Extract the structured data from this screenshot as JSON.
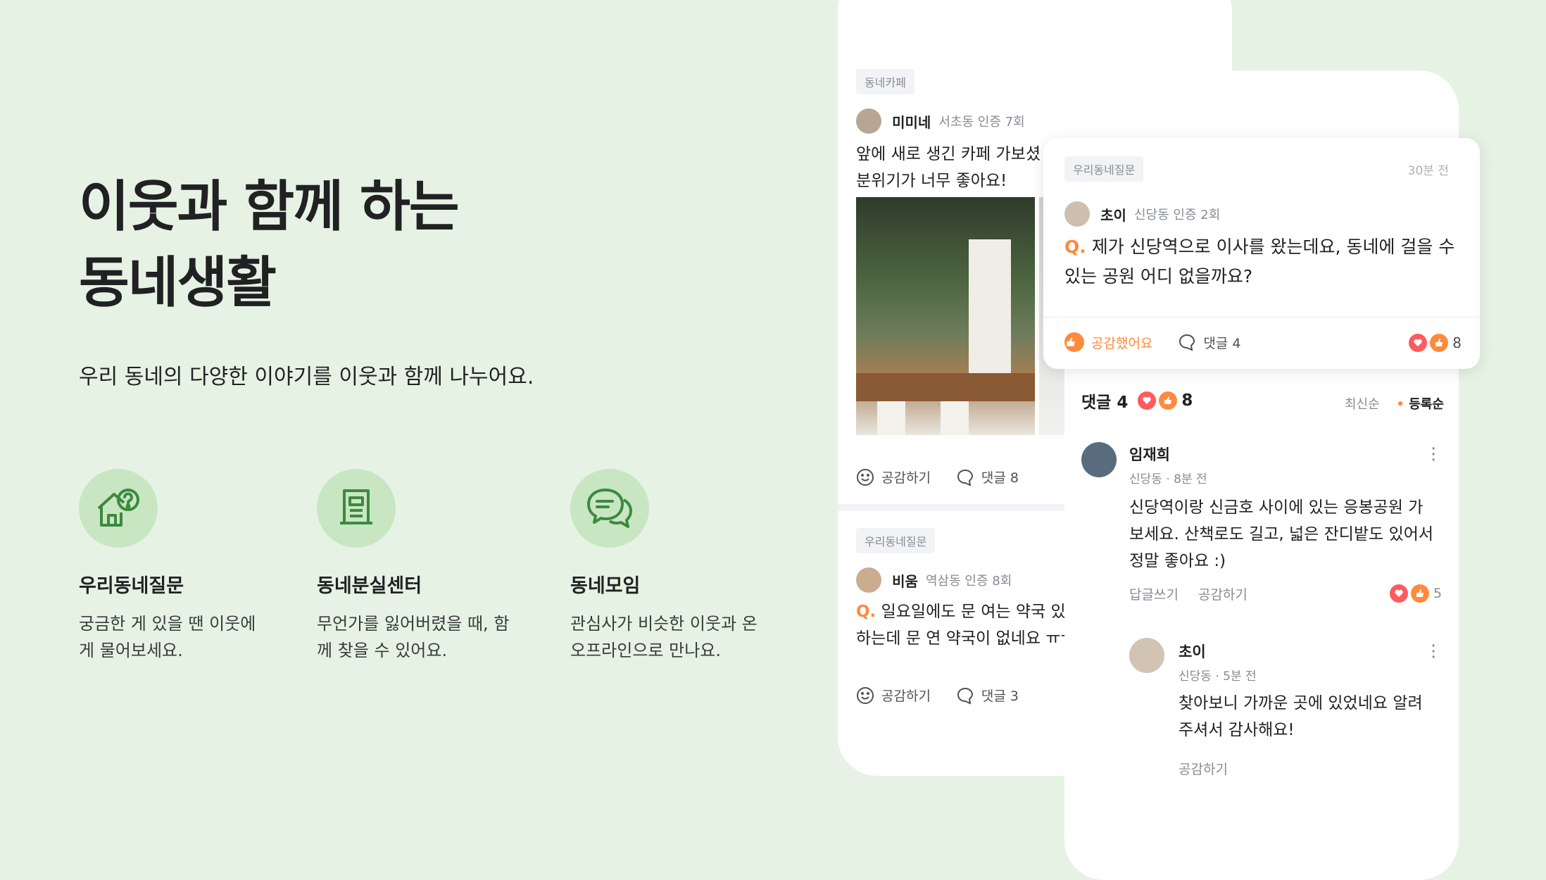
{
  "hero": {
    "title_line1": "이웃과 함께 하는",
    "title_line2": "동네생활",
    "subtitle": "우리 동네의 다양한 이야기를 이웃과 함께 나누어요."
  },
  "features": [
    {
      "icon": "house-question-icon",
      "title": "우리동네질문",
      "desc_line1": "궁금한 게 있을 땐 이웃에",
      "desc_line2": "게 물어보세요."
    },
    {
      "icon": "document-icon",
      "title": "동네분실센터",
      "desc_line1": "무언가를 잃어버렸을 때, 함",
      "desc_line2": "께 찾을 수 있어요."
    },
    {
      "icon": "chat-bubbles-icon",
      "title": "동네모임",
      "desc_line1": "관심사가 비슷한 이웃과 온",
      "desc_line2": "오프라인으로 만나요."
    }
  ],
  "phone1": {
    "post1": {
      "tag": "동네카페",
      "author": "미미네",
      "meta": "서초동 인증 7회",
      "text_line1": "앞에 새로 생긴 카페 가보셨",
      "text_line2": "분위기가 너무 좋아요!",
      "like_label": "공감하기",
      "comment_label": "댓글 8"
    },
    "post2": {
      "tag": "우리동네질문",
      "author": "비움",
      "meta": "역삼동 인증 8회",
      "q": "Q.",
      "text_line1": "일요일에도 문 여는 약국 있나",
      "text_line2": "하는데 문 연 약국이 없네요 ㅠㅠ",
      "like_label": "공감하기",
      "comment_label": "댓글 3"
    }
  },
  "question_card": {
    "tag": "우리동네질문",
    "time": "30분 전",
    "author": "초이",
    "meta": "신당동 인증 2회",
    "q": "Q.",
    "text_line1": "제가 신당역으로 이사를 왔는데요, 동네에 걸을 수",
    "text_line2": "있는 공원 어디 없을까요?",
    "liked_label": "공감했어요",
    "comment_label": "댓글 4",
    "reaction_count": "8"
  },
  "comments": {
    "header": "댓글 4",
    "reaction_count": "8",
    "sort_latest": "최신순",
    "sort_registered": "등록순",
    "c1": {
      "author": "임재희",
      "meta": "신당동 · 8분 전",
      "line1": "신당역이랑 신금호 사이에 있는 응봉공원 가",
      "line2": "보세요. 산책로도 길고, 넓은 잔디밭도 있어서",
      "line3": "정말 좋아요 :)",
      "reply_label": "답글쓰기",
      "like_label": "공감하기",
      "reaction_count": "5"
    },
    "c2": {
      "author": "초이",
      "meta": "신당동 · 5분 전",
      "line1": "찾아보니 가까운 곳에 있었네요 알려",
      "line2": "주셔서 감사해요!",
      "like_label": "공감하기"
    }
  },
  "colors": {
    "background": "#e6f3e4",
    "accent": "#ff8a3d",
    "heart": "#ff5a5f",
    "icon_green": "#3c8a3f"
  }
}
